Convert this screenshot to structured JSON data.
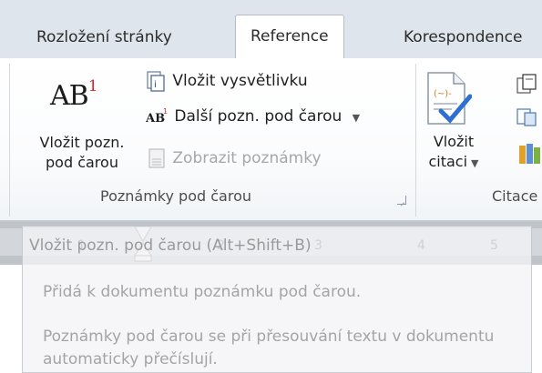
{
  "tabs": [
    {
      "label": "Rozložení stránky",
      "active": false
    },
    {
      "label": "Reference",
      "active": true
    },
    {
      "label": "Korespondence",
      "active": false
    }
  ],
  "ribbon": {
    "footnotes_group": {
      "label": "Poznámky pod čarou",
      "insert_footnote": {
        "line1": "Vložit pozn.",
        "line2": "pod čarou",
        "icon": "AB",
        "superscript": "1"
      },
      "insert_endnote": "Vložit vysvětlivku",
      "next_footnote": "Další pozn. pod čarou",
      "show_notes": "Zobrazit poznámky"
    },
    "citations_group": {
      "label": "Citace",
      "insert_citation": {
        "line1": "Vložit",
        "line2": "citaci"
      }
    }
  },
  "ruler": {
    "numbers": [
      "1",
      "2",
      "3",
      "4",
      "5"
    ]
  },
  "tooltip": {
    "title": "Vložit pozn. pod čarou (Alt+Shift+B)",
    "description": "Přidá k dokumentu poznámku pod čarou.",
    "details": "Poznámky pod čarou se při přesouvání textu v dokumentu automaticky přečíslují."
  },
  "colors": {
    "accent_red": "#d8262b",
    "tab_bar": "#dfe5ec",
    "citation_check": "#2e6fd4"
  }
}
